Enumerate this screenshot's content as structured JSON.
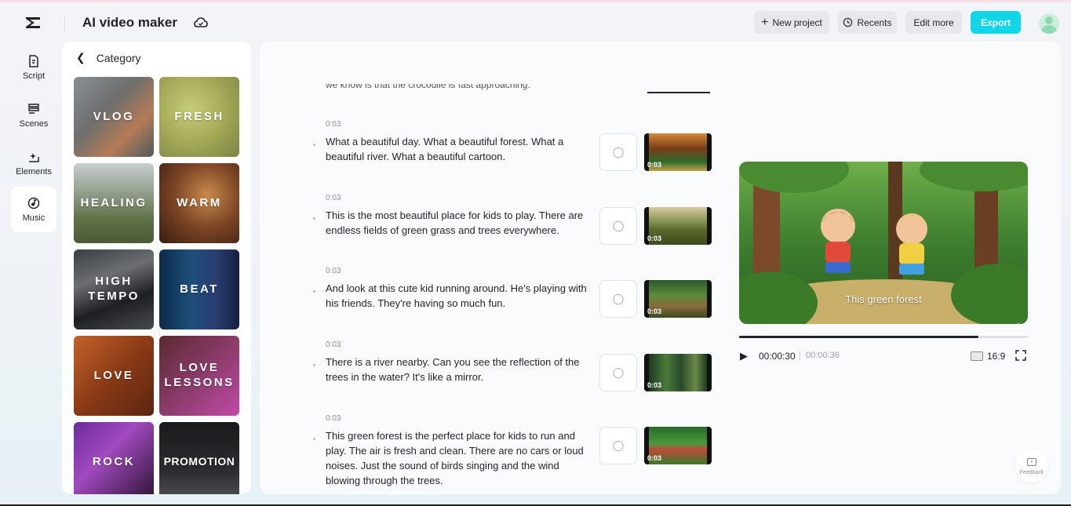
{
  "header": {
    "app_title": "AI video maker",
    "new_project": "New project",
    "recents": "Recents",
    "edit_more": "Edit more",
    "export": "Export"
  },
  "nav": [
    {
      "label": "Script",
      "icon": "script-icon"
    },
    {
      "label": "Scenes",
      "icon": "scenes-icon"
    },
    {
      "label": "Elements",
      "icon": "elements-icon"
    },
    {
      "label": "Music",
      "icon": "music-icon",
      "active": true
    }
  ],
  "category": {
    "title": "Category",
    "tiles": [
      "VLOG",
      "FRESH",
      "HEALING",
      "WARM",
      "HIGH TEMPO",
      "BEAT",
      "LOVE",
      "LOVE LESSONS",
      "ROCK",
      "PROMOTION"
    ]
  },
  "script": {
    "clipped_text": "we know is that the crocodile is fast approaching.",
    "scenes": [
      {
        "duration": "0:03",
        "text": "What a beautiful day. What a beautiful forest. What a beautiful river. What a beautiful cartoon.",
        "thumb_duration": "0:03"
      },
      {
        "duration": "0:03",
        "text": "This is the most beautiful place for kids to play. There are endless fields of green grass and trees everywhere.",
        "thumb_duration": "0:03"
      },
      {
        "duration": "0:03",
        "text": "And look at this cute kid running around. He's playing with his friends. They're having so much fun.",
        "thumb_duration": "0:03"
      },
      {
        "duration": "0:03",
        "text": "There is a river nearby. Can you see the reflection of the trees in the water? It's like a mirror.",
        "thumb_duration": "0:03"
      },
      {
        "duration": "0:03",
        "text": "This green forest is the perfect place for kids to run and play. The air is fresh and clean. There are no cars or loud noises. Just the sound of birds singing and the wind blowing through the trees.",
        "thumb_duration": "0:03"
      }
    ]
  },
  "player": {
    "caption": "This green forest",
    "current_time": "00:00:30",
    "total_time": "00:00:36",
    "progress": 0.83,
    "aspect_ratio": "16:9"
  },
  "feedback": "Feedback",
  "colors": {
    "accent": "#10d6e8"
  }
}
